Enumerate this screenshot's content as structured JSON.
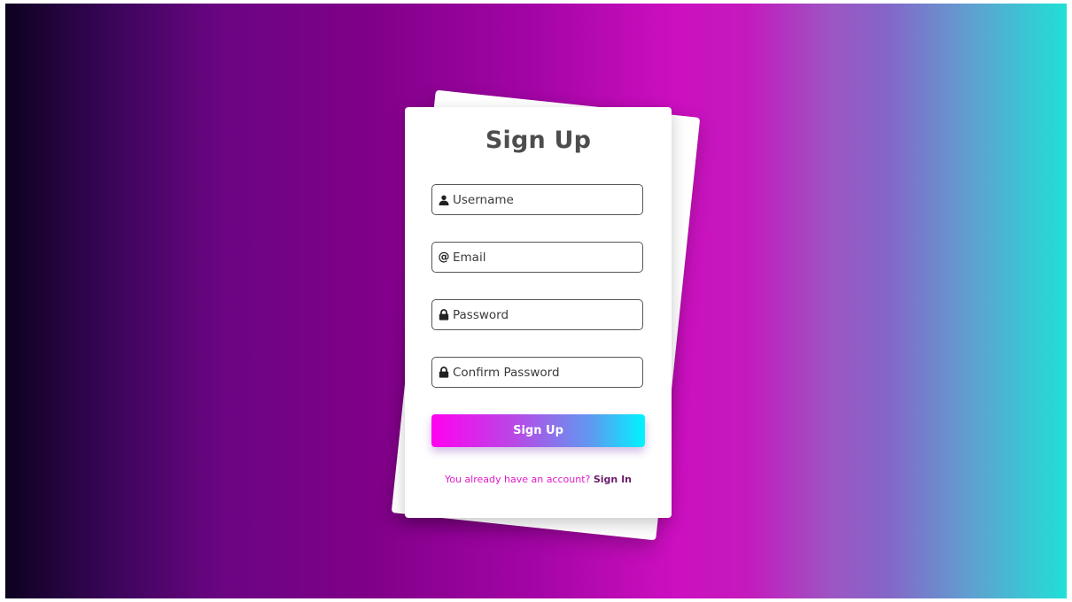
{
  "form": {
    "title": "Sign Up",
    "fields": [
      {
        "icon": "user-icon",
        "placeholder": "Username",
        "value": ""
      },
      {
        "icon": "at-icon",
        "placeholder": "Email",
        "value": ""
      },
      {
        "icon": "lock-icon",
        "placeholder": "Password",
        "value": ""
      },
      {
        "icon": "lock-icon",
        "placeholder": "Confirm Password",
        "value": ""
      }
    ],
    "submit_label": "Sign Up",
    "footer_question": "You already have an account?",
    "footer_link": "Sign In"
  },
  "colors": {
    "background_gradient": [
      "#0d0220",
      "#7f0088",
      "#cc0fc0",
      "#20e0d6"
    ],
    "button_gradient": [
      "#ff00ef",
      "#00f4ff"
    ],
    "footer_question": "#e01cc9",
    "footer_link": "#6b1b6b",
    "title": "#4d4d4d"
  }
}
